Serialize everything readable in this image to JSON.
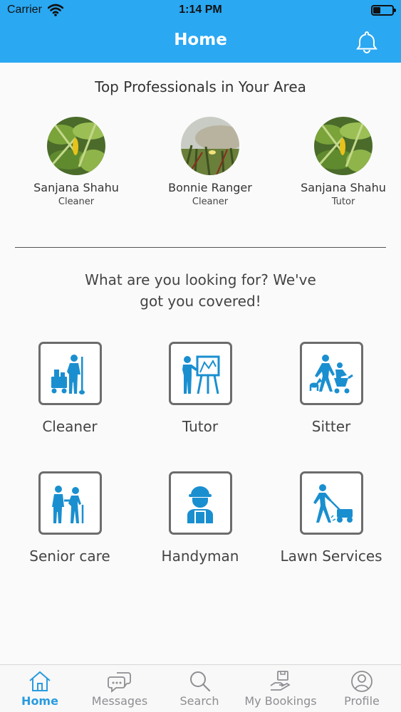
{
  "status_bar": {
    "carrier": "Carrier",
    "time": "1:14 PM",
    "battery_level": 0.3
  },
  "header": {
    "title": "Home"
  },
  "professionals": {
    "heading": "Top Professionals in Your Area",
    "items": [
      {
        "name": "Sanjana Shahu",
        "role": "Cleaner"
      },
      {
        "name": "Bonnie Ranger",
        "role": "Cleaner"
      },
      {
        "name": "Sanjana Shahu",
        "role": "Tutor"
      }
    ]
  },
  "services": {
    "heading": "What are you looking for? We've got you covered!",
    "items": [
      {
        "label": "Cleaner",
        "icon": "cleaner-icon"
      },
      {
        "label": "Tutor",
        "icon": "tutor-icon"
      },
      {
        "label": "Sitter",
        "icon": "sitter-icon"
      },
      {
        "label": "Senior care",
        "icon": "senior-care-icon"
      },
      {
        "label": "Handyman",
        "icon": "handyman-icon"
      },
      {
        "label": "Lawn Services",
        "icon": "lawn-services-icon"
      }
    ]
  },
  "tabs": [
    {
      "label": "Home",
      "icon": "home-icon",
      "active": true
    },
    {
      "label": "Messages",
      "icon": "messages-icon",
      "active": false
    },
    {
      "label": "Search",
      "icon": "search-icon",
      "active": false
    },
    {
      "label": "My Bookings",
      "icon": "bookings-icon",
      "active": false
    },
    {
      "label": "Profile",
      "icon": "profile-icon",
      "active": false
    }
  ],
  "colors": {
    "accent": "#2aa8f2",
    "icon_blue": "#1a8fd0",
    "active_tab": "#2a9be0",
    "inactive_tab": "#8e8e93"
  }
}
